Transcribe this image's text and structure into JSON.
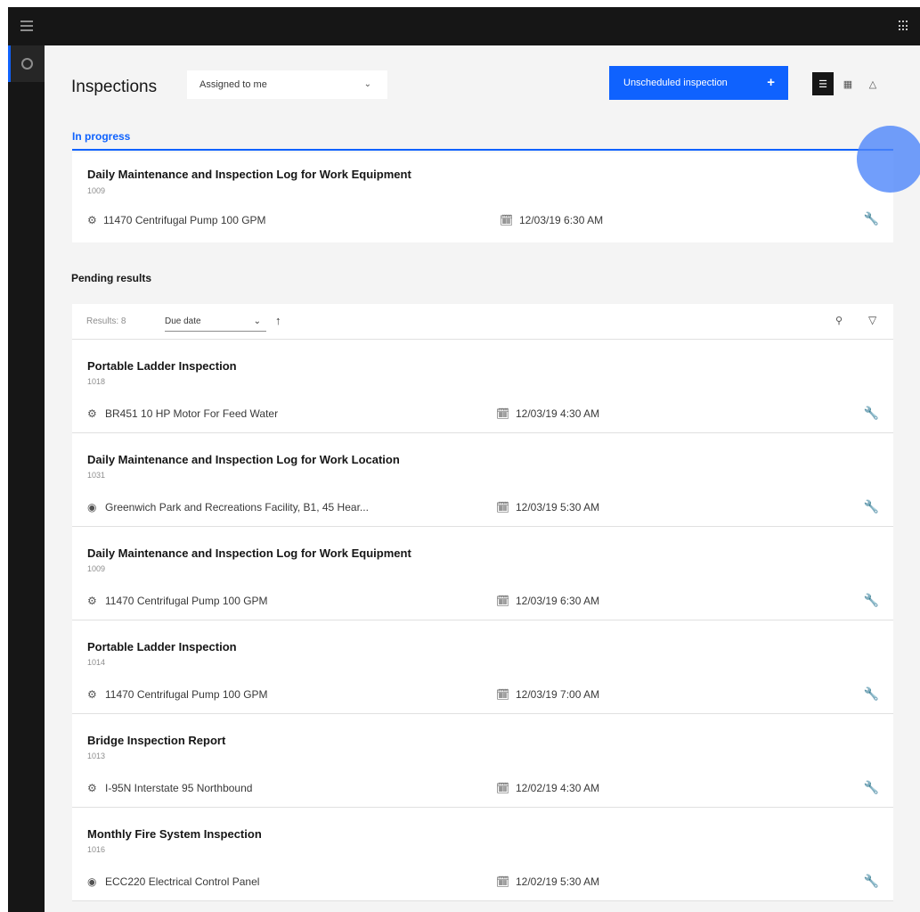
{
  "header": {
    "title": "Inspections",
    "filter_value": "Assigned to me",
    "primary_button_label": "Unscheduled inspection",
    "primary_button_icon": "plus-icon",
    "view_icons": [
      "list-view-icon",
      "grid-view-icon",
      "map-view-icon"
    ]
  },
  "tabs": {
    "active_label": "In progress"
  },
  "in_progress": {
    "title": "Daily Maintenance and Inspection Log for Work Equipment",
    "id": "1009",
    "asset": "11470 Centrifugal Pump 100 GPM",
    "asset_icon": "asset-icon",
    "date": "12/03/19 6:30 AM"
  },
  "pending": {
    "section_title": "Pending results",
    "results_count": "Results: 8",
    "sort_value": "Due date",
    "items": [
      {
        "title": "Portable Ladder Inspection",
        "id": "1018",
        "asset": "BR451 10 HP Motor For Feed Water",
        "icon": "asset",
        "date": "12/03/19 4:30 AM"
      },
      {
        "title": "Daily Maintenance and Inspection Log for Work Location",
        "id": "1031",
        "asset": "Greenwich Park and Recreations Facility, B1, 45 Hear...",
        "icon": "location",
        "date": "12/03/19 5:30 AM"
      },
      {
        "title": "Daily Maintenance and Inspection Log for Work Equipment",
        "id": "1009",
        "asset": "11470 Centrifugal Pump 100 GPM",
        "icon": "asset",
        "date": "12/03/19 6:30 AM"
      },
      {
        "title": "Portable Ladder Inspection",
        "id": "1014",
        "asset": "11470 Centrifugal Pump 100 GPM",
        "icon": "asset",
        "date": "12/03/19 7:00 AM"
      },
      {
        "title": "Bridge Inspection Report",
        "id": "1013",
        "asset": "I-95N Interstate 95 Northbound",
        "icon": "asset",
        "date": "12/02/19 4:30 AM"
      },
      {
        "title": "Monthly Fire System Inspection",
        "id": "1016",
        "asset": "ECC220 Electrical Control Panel",
        "icon": "location",
        "date": "12/02/19 5:30 AM"
      }
    ]
  },
  "colors": {
    "accent": "#0f62fe",
    "topbar": "#161616",
    "background": "#f4f4f4"
  }
}
